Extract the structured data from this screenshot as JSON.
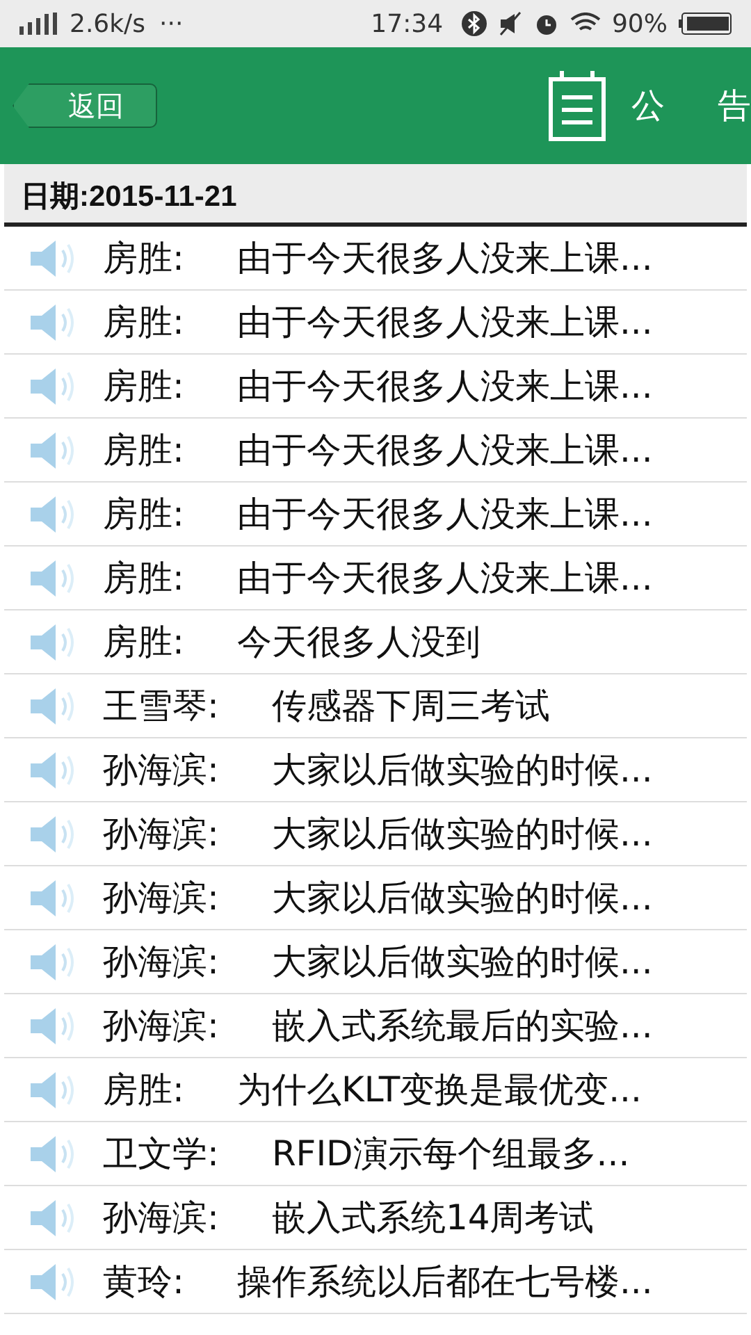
{
  "status_bar": {
    "signal_speed": "2.6k/s",
    "more": "···",
    "time": "17:34",
    "battery": "90%"
  },
  "header": {
    "back": "返回",
    "title": [
      "公",
      "告"
    ]
  },
  "date_label": "日期:2015-11-21",
  "messages": [
    {
      "sender": "房胜:",
      "text": "由于今天很多人没来上课..."
    },
    {
      "sender": "房胜:",
      "text": "由于今天很多人没来上课..."
    },
    {
      "sender": "房胜:",
      "text": "由于今天很多人没来上课..."
    },
    {
      "sender": "房胜:",
      "text": "由于今天很多人没来上课..."
    },
    {
      "sender": "房胜:",
      "text": "由于今天很多人没来上课..."
    },
    {
      "sender": "房胜:",
      "text": "由于今天很多人没来上课..."
    },
    {
      "sender": "房胜:",
      "text": "今天很多人没到"
    },
    {
      "sender": "王雪琴:",
      "text": "传感器下周三考试"
    },
    {
      "sender": "孙海滨:",
      "text": "大家以后做实验的时候..."
    },
    {
      "sender": "孙海滨:",
      "text": "大家以后做实验的时候..."
    },
    {
      "sender": "孙海滨:",
      "text": "大家以后做实验的时候..."
    },
    {
      "sender": "孙海滨:",
      "text": "大家以后做实验的时候..."
    },
    {
      "sender": "孙海滨:",
      "text": "嵌入式系统最后的实验..."
    },
    {
      "sender": "房胜:",
      "text": "为什么KLT变换是最优变..."
    },
    {
      "sender": "卫文学:",
      "text": "RFID演示每个组最多..."
    },
    {
      "sender": "孙海滨:",
      "text": "嵌入式系统14周考试"
    },
    {
      "sender": "黄玲:",
      "text": "操作系统以后都在七号楼..."
    }
  ]
}
